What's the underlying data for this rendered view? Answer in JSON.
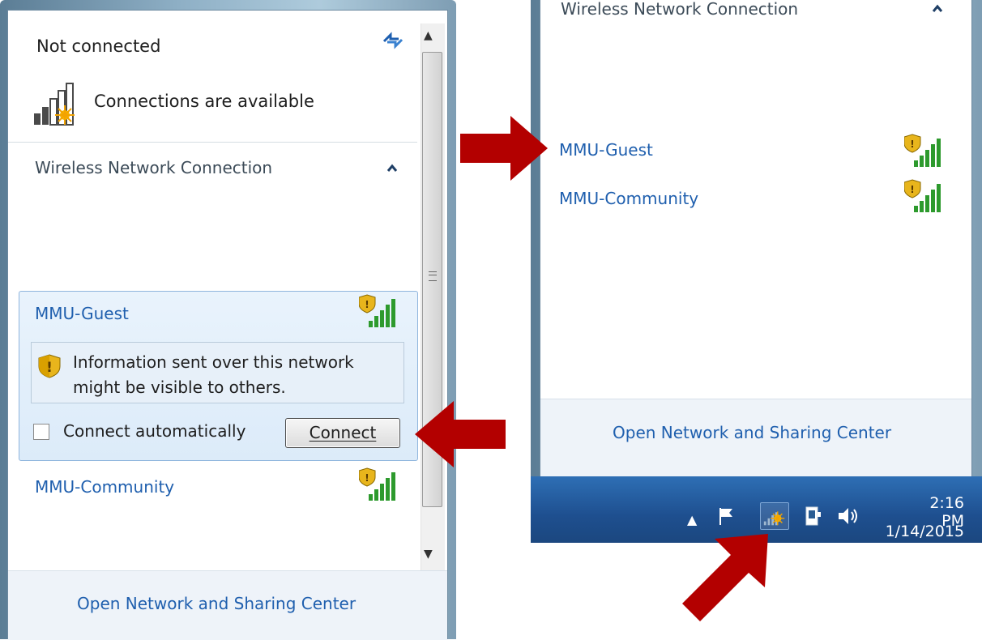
{
  "left_panel": {
    "status_title": "Not connected",
    "connections_label": "Connections are available",
    "section_title": "Wireless Network Connection",
    "networks": [
      {
        "name": "MMU-Guest",
        "warning_line1": "Information sent over this network",
        "warning_line2": "might be visible to others.",
        "auto_connect_label": "Connect automatically",
        "auto_connect_checked": false,
        "connect_button": "Connect"
      },
      {
        "name": "MMU-Community"
      }
    ],
    "footer_link": "Open Network and Sharing Center"
  },
  "right_panel": {
    "section_title": "Wireless Network Connection",
    "networks": [
      {
        "name": "MMU-Guest"
      },
      {
        "name": "MMU-Community"
      }
    ],
    "footer_link": "Open Network and Sharing Center"
  },
  "taskbar": {
    "time": "2:16 PM",
    "date": "1/14/2015",
    "tray_icons": [
      "show-hidden-icons",
      "action-center-flag-icon",
      "wireless-network-icon",
      "power-icon",
      "volume-icon"
    ]
  },
  "colors": {
    "link_blue": "#1f5fae",
    "arrow_red": "#b30000",
    "taskbar_blue": "#1e4f8f",
    "card_highlight": "#dcebf9",
    "signal_green": "#2d9a2d",
    "warning_shield_yellow": "#e8b51c"
  },
  "icons": {
    "refresh": "refresh-icon",
    "connections": "signal-bars-star-icon",
    "collapse": "chevron-up-icon",
    "secured_signal": "shield-signal-icon",
    "warning": "shield-warning-icon",
    "callout": "red-arrow-icon"
  }
}
